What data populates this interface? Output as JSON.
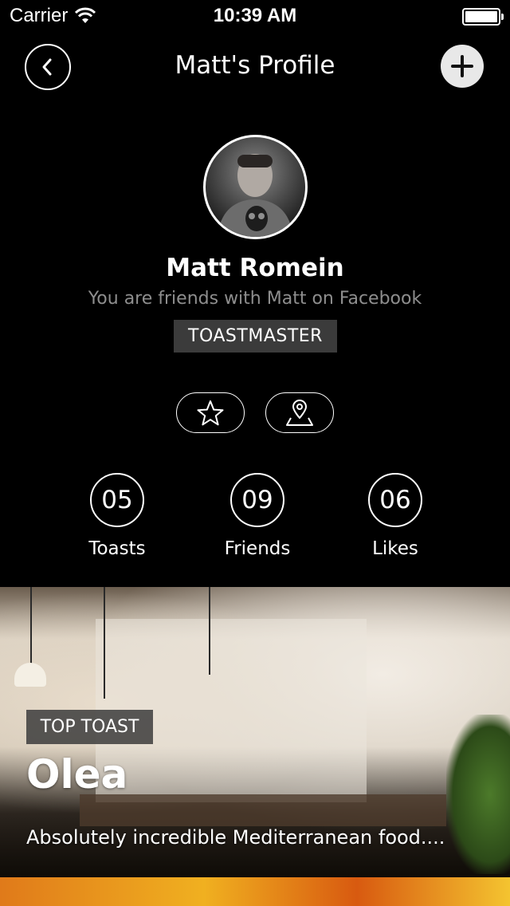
{
  "status_bar": {
    "carrier": "Carrier",
    "time": "10:39 AM"
  },
  "nav": {
    "title": "Matt's Profile"
  },
  "profile": {
    "name": "Matt Romein",
    "friend_note": "You are friends with Matt on Facebook",
    "badge": "TOASTMASTER"
  },
  "actions": {
    "favorite_icon": "star-icon",
    "location_icon": "map-pin-icon"
  },
  "stats": [
    {
      "value": "05",
      "label": "Toasts"
    },
    {
      "value": "09",
      "label": "Friends"
    },
    {
      "value": "06",
      "label": "Likes"
    }
  ],
  "top_toast": {
    "badge": "TOP TOAST",
    "venue": "Olea",
    "description": "Absolutely incredible Mediterranean food...."
  }
}
